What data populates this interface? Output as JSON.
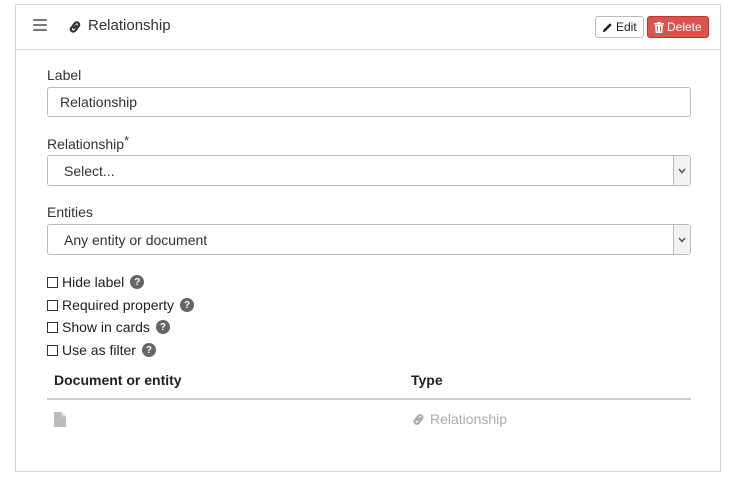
{
  "header": {
    "title": "Relationship",
    "edit_label": "Edit",
    "delete_label": "Delete"
  },
  "form": {
    "label_field": {
      "label": "Label",
      "value": "Relationship"
    },
    "relationship_field": {
      "label": "Relationship",
      "required_marker": "*",
      "selected": "Select..."
    },
    "entities_field": {
      "label": "Entities",
      "selected": "Any entity or document"
    }
  },
  "checkboxes": [
    {
      "label": "Hide label",
      "checked": false
    },
    {
      "label": "Required property",
      "checked": false
    },
    {
      "label": "Show in cards",
      "checked": false
    },
    {
      "label": "Use as filter",
      "checked": false
    }
  ],
  "help_glyph": "?",
  "table": {
    "headers": [
      "Document or entity",
      "Type"
    ],
    "rows": [
      {
        "type": "Relationship"
      }
    ]
  },
  "icons": {
    "drag": "drag-handle-icon",
    "link": "link-icon",
    "pencil": "pencil-icon",
    "trash": "trash-icon",
    "help": "question-circle-icon",
    "file": "file-icon",
    "chevron": "chevron-down-icon"
  },
  "colors": {
    "delete_bg": "#d9534f",
    "muted_text": "#aaaaaa",
    "border": "#bbbbbb"
  }
}
